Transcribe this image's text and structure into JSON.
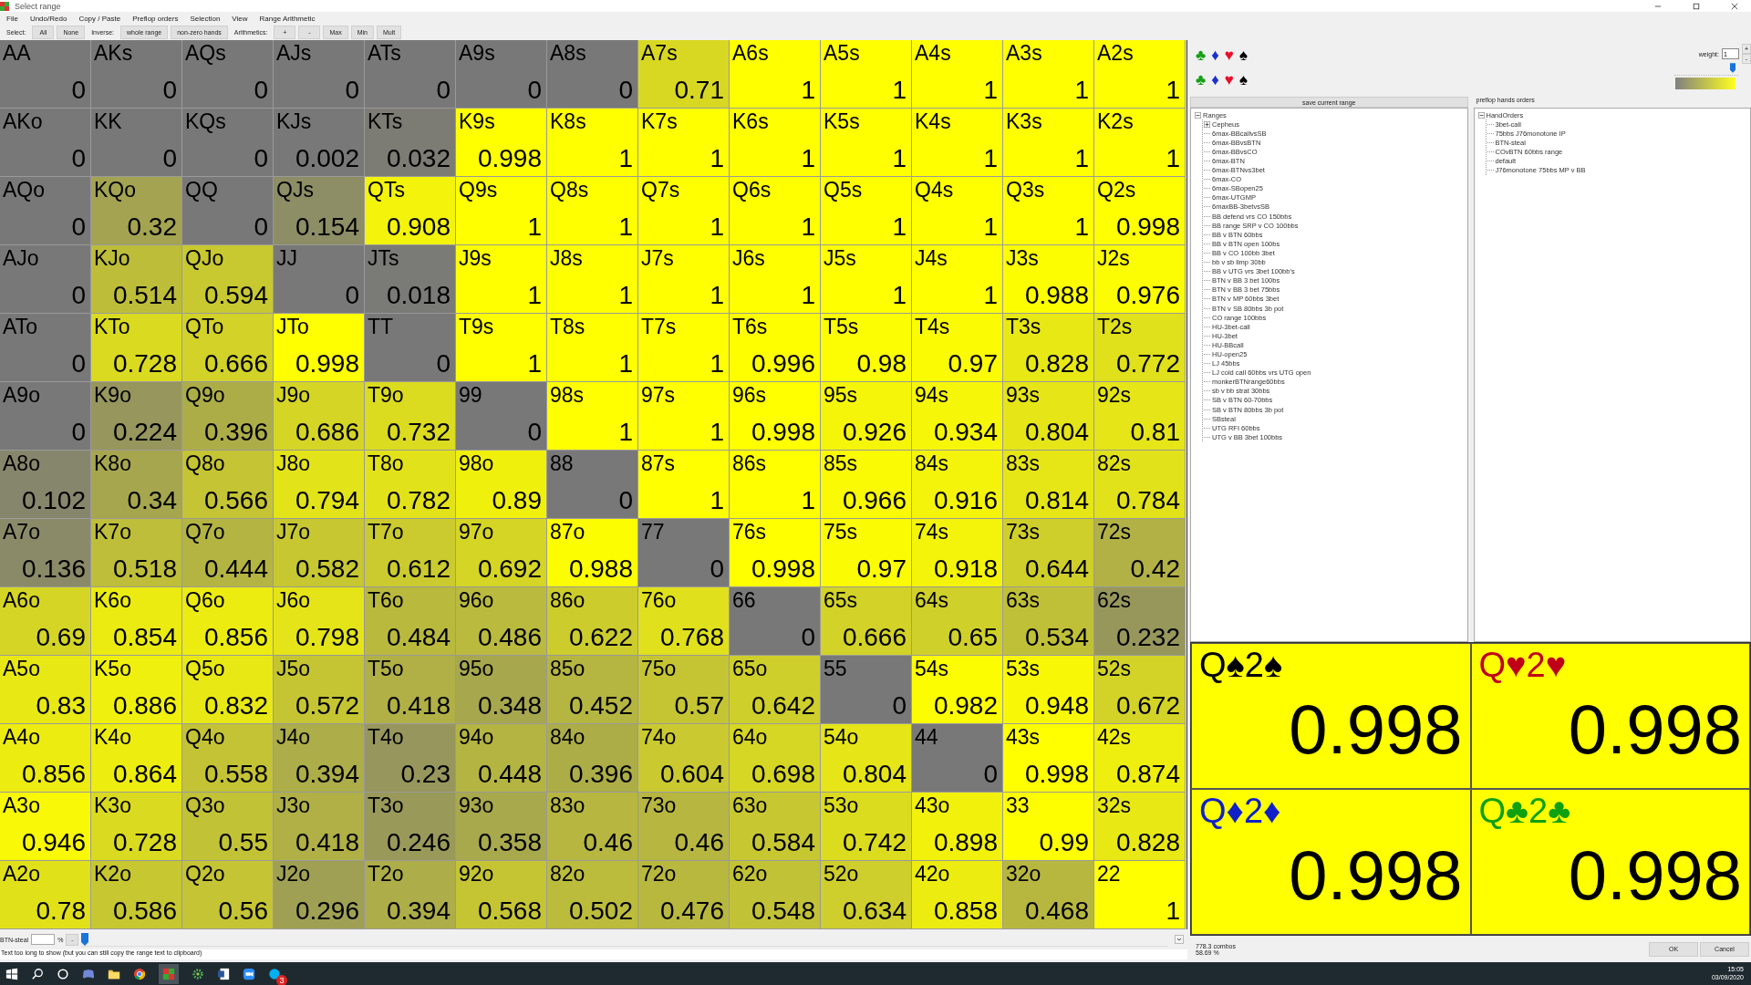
{
  "window": {
    "title": "Select range"
  },
  "menu": [
    "File",
    "Undo/Redo",
    "Copy / Paste",
    "Preflop orders",
    "Selection",
    "View",
    "Range Arithmetic"
  ],
  "toolbar": [
    {
      "kind": "label",
      "text": "Select:"
    },
    {
      "kind": "button",
      "text": "All"
    },
    {
      "kind": "button",
      "text": "None"
    },
    {
      "kind": "label",
      "text": "Inverse:"
    },
    {
      "kind": "button",
      "text": "whole range"
    },
    {
      "kind": "button",
      "text": "non-zero hands"
    },
    {
      "kind": "label",
      "text": "Arithmetics:"
    },
    {
      "kind": "button",
      "text": "+"
    },
    {
      "kind": "button",
      "text": "-"
    },
    {
      "kind": "button",
      "text": "Max"
    },
    {
      "kind": "button",
      "text": "Min"
    },
    {
      "kind": "button",
      "text": "Mult"
    }
  ],
  "grid": [
    {
      "cells": [
        {
          "hand": "AA",
          "value": "0",
          "color": "#787878"
        },
        {
          "hand": "AKs",
          "value": "0",
          "color": "#787878"
        },
        {
          "hand": "AQs",
          "value": "0",
          "color": "#787878"
        },
        {
          "hand": "AJs",
          "value": "0",
          "color": "#787878"
        },
        {
          "hand": "ATs",
          "value": "0",
          "color": "#787878"
        },
        {
          "hand": "A9s",
          "value": "0",
          "color": "#787878"
        },
        {
          "hand": "A8s",
          "value": "0",
          "color": "#787878"
        },
        {
          "hand": "A7s",
          "value": "0.71",
          "color": "#d8d823"
        },
        {
          "hand": "A6s",
          "value": "1",
          "color": "#ffff00"
        },
        {
          "hand": "A5s",
          "value": "1",
          "color": "#ffff00"
        },
        {
          "hand": "A4s",
          "value": "1",
          "color": "#ffff00"
        },
        {
          "hand": "A3s",
          "value": "1",
          "color": "#ffff00"
        },
        {
          "hand": "A2s",
          "value": "1",
          "color": "#ffff00"
        }
      ]
    },
    {
      "cells": [
        {
          "hand": "AKo",
          "value": "0",
          "color": "#787878"
        },
        {
          "hand": "KK",
          "value": "0",
          "color": "#787878"
        },
        {
          "hand": "KQs",
          "value": "0",
          "color": "#787878"
        },
        {
          "hand": "KJs",
          "value": "0.002",
          "color": "#787878"
        },
        {
          "hand": "KTs",
          "value": "0.032",
          "color": "#7c7c74"
        },
        {
          "hand": "K9s",
          "value": "0.998",
          "color": "#ffff00"
        },
        {
          "hand": "K8s",
          "value": "1",
          "color": "#ffff00"
        },
        {
          "hand": "K7s",
          "value": "1",
          "color": "#ffff00"
        },
        {
          "hand": "K6s",
          "value": "1",
          "color": "#ffff00"
        },
        {
          "hand": "K5s",
          "value": "1",
          "color": "#ffff00"
        },
        {
          "hand": "K4s",
          "value": "1",
          "color": "#ffff00"
        },
        {
          "hand": "K3s",
          "value": "1",
          "color": "#ffff00"
        },
        {
          "hand": "K2s",
          "value": "1",
          "color": "#ffff00"
        }
      ]
    },
    {
      "cells": [
        {
          "hand": "AQo",
          "value": "0",
          "color": "#787878"
        },
        {
          "hand": "KQo",
          "value": "0.32",
          "color": "#a3a352"
        },
        {
          "hand": "QQ",
          "value": "0",
          "color": "#787878"
        },
        {
          "hand": "QJs",
          "value": "0.154",
          "color": "#8d8d66"
        },
        {
          "hand": "QTs",
          "value": "0.908",
          "color": "#f3f30b"
        },
        {
          "hand": "Q9s",
          "value": "1",
          "color": "#ffff00"
        },
        {
          "hand": "Q8s",
          "value": "1",
          "color": "#ffff00"
        },
        {
          "hand": "Q7s",
          "value": "1",
          "color": "#ffff00"
        },
        {
          "hand": "Q6s",
          "value": "1",
          "color": "#ffff00"
        },
        {
          "hand": "Q5s",
          "value": "1",
          "color": "#ffff00"
        },
        {
          "hand": "Q4s",
          "value": "1",
          "color": "#ffff00"
        },
        {
          "hand": "Q3s",
          "value": "1",
          "color": "#ffff00"
        },
        {
          "hand": "Q2s",
          "value": "0.998",
          "color": "#ffff00"
        }
      ]
    },
    {
      "cells": [
        {
          "hand": "AJo",
          "value": "0",
          "color": "#787878"
        },
        {
          "hand": "KJo",
          "value": "0.514",
          "color": "#bdbd3a"
        },
        {
          "hand": "QJo",
          "value": "0.594",
          "color": "#c8c831"
        },
        {
          "hand": "JJ",
          "value": "0",
          "color": "#787878"
        },
        {
          "hand": "JTs",
          "value": "0.018",
          "color": "#7a7a76"
        },
        {
          "hand": "J9s",
          "value": "1",
          "color": "#ffff00"
        },
        {
          "hand": "J8s",
          "value": "1",
          "color": "#ffff00"
        },
        {
          "hand": "J7s",
          "value": "1",
          "color": "#ffff00"
        },
        {
          "hand": "J6s",
          "value": "1",
          "color": "#ffff00"
        },
        {
          "hand": "J5s",
          "value": "1",
          "color": "#ffff00"
        },
        {
          "hand": "J4s",
          "value": "1",
          "color": "#ffff00"
        },
        {
          "hand": "J3s",
          "value": "0.988",
          "color": "#fdfd01"
        },
        {
          "hand": "J2s",
          "value": "0.976",
          "color": "#fcfc03"
        }
      ]
    },
    {
      "cells": [
        {
          "hand": "ATo",
          "value": "0",
          "color": "#787878"
        },
        {
          "hand": "KTo",
          "value": "0.728",
          "color": "#dada21"
        },
        {
          "hand": "QTo",
          "value": "0.666",
          "color": "#d2d228"
        },
        {
          "hand": "JTo",
          "value": "0.998",
          "color": "#ffff00"
        },
        {
          "hand": "TT",
          "value": "0",
          "color": "#787878"
        },
        {
          "hand": "T9s",
          "value": "1",
          "color": "#ffff00"
        },
        {
          "hand": "T8s",
          "value": "1",
          "color": "#ffff00"
        },
        {
          "hand": "T7s",
          "value": "1",
          "color": "#ffff00"
        },
        {
          "hand": "T6s",
          "value": "0.996",
          "color": "#fefe00"
        },
        {
          "hand": "T5s",
          "value": "0.98",
          "color": "#fcfc02"
        },
        {
          "hand": "T4s",
          "value": "0.97",
          "color": "#fbfb04"
        },
        {
          "hand": "T3s",
          "value": "0.828",
          "color": "#e8e815"
        },
        {
          "hand": "T2s",
          "value": "0.772",
          "color": "#e0e01b"
        }
      ]
    },
    {
      "cells": [
        {
          "hand": "A9o",
          "value": "0",
          "color": "#787878"
        },
        {
          "hand": "K9o",
          "value": "0.224",
          "color": "#96965d"
        },
        {
          "hand": "Q9o",
          "value": "0.396",
          "color": "#adad48"
        },
        {
          "hand": "J9o",
          "value": "0.686",
          "color": "#d5d526"
        },
        {
          "hand": "T9o",
          "value": "0.732",
          "color": "#dbdb20"
        },
        {
          "hand": "99",
          "value": "0",
          "color": "#787878"
        },
        {
          "hand": "98s",
          "value": "1",
          "color": "#ffff00"
        },
        {
          "hand": "97s",
          "value": "1",
          "color": "#ffff00"
        },
        {
          "hand": "96s",
          "value": "0.998",
          "color": "#ffff00"
        },
        {
          "hand": "95s",
          "value": "0.926",
          "color": "#f5f509"
        },
        {
          "hand": "94s",
          "value": "0.934",
          "color": "#f6f608"
        },
        {
          "hand": "93s",
          "value": "0.804",
          "color": "#e5e518"
        },
        {
          "hand": "92s",
          "value": "0.81",
          "color": "#e5e517"
        }
      ]
    },
    {
      "cells": [
        {
          "hand": "A8o",
          "value": "0.102",
          "color": "#86866c"
        },
        {
          "hand": "K8o",
          "value": "0.34",
          "color": "#a6a64f"
        },
        {
          "hand": "Q8o",
          "value": "0.566",
          "color": "#c4c434"
        },
        {
          "hand": "J8o",
          "value": "0.794",
          "color": "#e3e319"
        },
        {
          "hand": "T8o",
          "value": "0.782",
          "color": "#e2e21a"
        },
        {
          "hand": "98o",
          "value": "0.89",
          "color": "#f0f00d"
        },
        {
          "hand": "88",
          "value": "0",
          "color": "#787878"
        },
        {
          "hand": "87s",
          "value": "1",
          "color": "#ffff00"
        },
        {
          "hand": "86s",
          "value": "1",
          "color": "#ffff00"
        },
        {
          "hand": "85s",
          "value": "0.966",
          "color": "#fafa04"
        },
        {
          "hand": "84s",
          "value": "0.916",
          "color": "#f4f40a"
        },
        {
          "hand": "83s",
          "value": "0.814",
          "color": "#e6e616"
        },
        {
          "hand": "82s",
          "value": "0.784",
          "color": "#e2e21a"
        }
      ]
    },
    {
      "cells": [
        {
          "hand": "A7o",
          "value": "0.136",
          "color": "#8a8a68"
        },
        {
          "hand": "K7o",
          "value": "0.518",
          "color": "#bebe3a"
        },
        {
          "hand": "Q7o",
          "value": "0.444",
          "color": "#b4b443"
        },
        {
          "hand": "J7o",
          "value": "0.582",
          "color": "#c7c732"
        },
        {
          "hand": "T7o",
          "value": "0.612",
          "color": "#cbcb2f"
        },
        {
          "hand": "97o",
          "value": "0.692",
          "color": "#d5d525"
        },
        {
          "hand": "87o",
          "value": "0.988",
          "color": "#fdfd01"
        },
        {
          "hand": "77",
          "value": "0",
          "color": "#787878"
        },
        {
          "hand": "76s",
          "value": "0.998",
          "color": "#ffff00"
        },
        {
          "hand": "75s",
          "value": "0.97",
          "color": "#fbfb04"
        },
        {
          "hand": "74s",
          "value": "0.918",
          "color": "#f4f40a"
        },
        {
          "hand": "73s",
          "value": "0.644",
          "color": "#cfcf2b"
        },
        {
          "hand": "72s",
          "value": "0.42",
          "color": "#b1b146"
        }
      ]
    },
    {
      "cells": [
        {
          "hand": "A6o",
          "value": "0.69",
          "color": "#d5d525"
        },
        {
          "hand": "K6o",
          "value": "0.854",
          "color": "#ebeb12"
        },
        {
          "hand": "Q6o",
          "value": "0.856",
          "color": "#ecec11"
        },
        {
          "hand": "J6o",
          "value": "0.798",
          "color": "#e4e418"
        },
        {
          "hand": "T6o",
          "value": "0.484",
          "color": "#b9b93e"
        },
        {
          "hand": "96o",
          "value": "0.486",
          "color": "#baba3e"
        },
        {
          "hand": "86o",
          "value": "0.622",
          "color": "#cccc2d"
        },
        {
          "hand": "76o",
          "value": "0.768",
          "color": "#e0e01c"
        },
        {
          "hand": "66",
          "value": "0",
          "color": "#787878"
        },
        {
          "hand": "65s",
          "value": "0.666",
          "color": "#d2d228"
        },
        {
          "hand": "64s",
          "value": "0.65",
          "color": "#d0d02a"
        },
        {
          "hand": "63s",
          "value": "0.534",
          "color": "#c0c038"
        },
        {
          "hand": "62s",
          "value": "0.232",
          "color": "#97975c"
        }
      ]
    },
    {
      "cells": [
        {
          "hand": "A5o",
          "value": "0.83",
          "color": "#e8e814"
        },
        {
          "hand": "K5o",
          "value": "0.886",
          "color": "#f0f00e"
        },
        {
          "hand": "Q5o",
          "value": "0.832",
          "color": "#e8e815"
        },
        {
          "hand": "J5o",
          "value": "0.572",
          "color": "#c5c533"
        },
        {
          "hand": "T5o",
          "value": "0.418",
          "color": "#b0b046"
        },
        {
          "hand": "95o",
          "value": "0.348",
          "color": "#a7a74e"
        },
        {
          "hand": "85o",
          "value": "0.452",
          "color": "#b5b542"
        },
        {
          "hand": "75o",
          "value": "0.57",
          "color": "#c5c534"
        },
        {
          "hand": "65o",
          "value": "0.642",
          "color": "#cfcf2c"
        },
        {
          "hand": "55",
          "value": "0",
          "color": "#787878"
        },
        {
          "hand": "54s",
          "value": "0.982",
          "color": "#fdfd02"
        },
        {
          "hand": "53s",
          "value": "0.948",
          "color": "#f8f806"
        },
        {
          "hand": "52s",
          "value": "0.672",
          "color": "#d3d327"
        }
      ]
    },
    {
      "cells": [
        {
          "hand": "A4o",
          "value": "0.856",
          "color": "#ecec11"
        },
        {
          "hand": "K4o",
          "value": "0.864",
          "color": "#eded10"
        },
        {
          "hand": "Q4o",
          "value": "0.558",
          "color": "#c3c335"
        },
        {
          "hand": "J4o",
          "value": "0.394",
          "color": "#adad49"
        },
        {
          "hand": "T4o",
          "value": "0.23",
          "color": "#97975d"
        },
        {
          "hand": "94o",
          "value": "0.448",
          "color": "#b4b442"
        },
        {
          "hand": "84o",
          "value": "0.396",
          "color": "#adad48"
        },
        {
          "hand": "74o",
          "value": "0.604",
          "color": "#caca30"
        },
        {
          "hand": "64o",
          "value": "0.698",
          "color": "#d6d624"
        },
        {
          "hand": "54o",
          "value": "0.804",
          "color": "#e5e518"
        },
        {
          "hand": "44",
          "value": "0",
          "color": "#787878"
        },
        {
          "hand": "43s",
          "value": "0.998",
          "color": "#ffff00"
        },
        {
          "hand": "42s",
          "value": "0.874",
          "color": "#eeee0f"
        }
      ]
    },
    {
      "cells": [
        {
          "hand": "A3o",
          "value": "0.946",
          "color": "#f8f807"
        },
        {
          "hand": "K3o",
          "value": "0.728",
          "color": "#dada21"
        },
        {
          "hand": "Q3o",
          "value": "0.55",
          "color": "#c2c236"
        },
        {
          "hand": "J3o",
          "value": "0.418",
          "color": "#b0b046"
        },
        {
          "hand": "T3o",
          "value": "0.246",
          "color": "#99995a"
        },
        {
          "hand": "93o",
          "value": "0.358",
          "color": "#a8a84d"
        },
        {
          "hand": "83o",
          "value": "0.46",
          "color": "#b6b641"
        },
        {
          "hand": "73o",
          "value": "0.46",
          "color": "#b6b641"
        },
        {
          "hand": "63o",
          "value": "0.584",
          "color": "#c7c732"
        },
        {
          "hand": "53o",
          "value": "0.742",
          "color": "#dcdc1f"
        },
        {
          "hand": "43o",
          "value": "0.898",
          "color": "#f1f10c"
        },
        {
          "hand": "33",
          "value": "0.99",
          "color": "#fefe01"
        },
        {
          "hand": "32s",
          "value": "0.828",
          "color": "#e8e815"
        }
      ]
    },
    {
      "cells": [
        {
          "hand": "A2o",
          "value": "0.78",
          "color": "#e1e11a"
        },
        {
          "hand": "K2o",
          "value": "0.586",
          "color": "#c7c731"
        },
        {
          "hand": "Q2o",
          "value": "0.56",
          "color": "#c4c435"
        },
        {
          "hand": "J2o",
          "value": "0.296",
          "color": "#a0a054"
        },
        {
          "hand": "T2o",
          "value": "0.394",
          "color": "#adad49"
        },
        {
          "hand": "92o",
          "value": "0.568",
          "color": "#c5c534"
        },
        {
          "hand": "82o",
          "value": "0.502",
          "color": "#bcbc3c"
        },
        {
          "hand": "72o",
          "value": "0.476",
          "color": "#b8b83f"
        },
        {
          "hand": "62o",
          "value": "0.548",
          "color": "#c2c236"
        },
        {
          "hand": "52o",
          "value": "0.634",
          "color": "#cece2c"
        },
        {
          "hand": "42o",
          "value": "0.858",
          "color": "#ecec11"
        },
        {
          "hand": "32o",
          "value": "0.468",
          "color": "#b7b740"
        },
        {
          "hand": "22",
          "value": "1",
          "color": "#ffff00"
        }
      ]
    }
  ],
  "steal_bar": {
    "label": "BTN-steal",
    "unit": "%",
    "button": "-",
    "level": 0
  },
  "status_text": "Text too long to show (but you can still copy the range text to clipboard)",
  "suit_rows": [
    {
      "suits": [
        {
          "symbol": "♣",
          "color": "#14a014"
        },
        {
          "symbol": "♦",
          "color": "#1c2fd0"
        },
        {
          "symbol": "♥",
          "color": "#e8102a"
        },
        {
          "symbol": "♠",
          "color": "#000000"
        }
      ]
    },
    {
      "suits": [
        {
          "symbol": "♣",
          "color": "#14a014"
        },
        {
          "symbol": "♦",
          "color": "#1c2fd0"
        },
        {
          "symbol": "♥",
          "color": "#e8102a"
        },
        {
          "symbol": "♠",
          "color": "#000000"
        }
      ]
    }
  ],
  "weight": {
    "label": "weight:",
    "value": "1",
    "plus": "+",
    "minus": "-",
    "level": 0.95
  },
  "ranges_panel": {
    "button": "save current range",
    "tree": [
      {
        "label": "Ranges",
        "kind": "folder",
        "expanded": true,
        "children": [
          {
            "label": "Cepheus",
            "kind": "folder",
            "expanded": false
          },
          {
            "label": "6max-BBcallvsSB",
            "kind": "leaf"
          },
          {
            "label": "6max-BBvsBTN",
            "kind": "leaf"
          },
          {
            "label": "6max-BBvsCO",
            "kind": "leaf"
          },
          {
            "label": "6max-BTN",
            "kind": "leaf"
          },
          {
            "label": "6max-BTNvs3bet",
            "kind": "leaf"
          },
          {
            "label": "6max-CO",
            "kind": "leaf"
          },
          {
            "label": "6max-SBopen25",
            "kind": "leaf"
          },
          {
            "label": "6max-UTGMP",
            "kind": "leaf"
          },
          {
            "label": "6maxBB-3betvsSB",
            "kind": "leaf"
          },
          {
            "label": "BB defend vrs CO 150bbs",
            "kind": "leaf"
          },
          {
            "label": "BB range SRP v CO 100bbs",
            "kind": "leaf"
          },
          {
            "label": "BB v BTN 60bbs",
            "kind": "leaf"
          },
          {
            "label": "BB v BTN open 100bs",
            "kind": "leaf"
          },
          {
            "label": "BB v CO 100bb 3bet",
            "kind": "leaf"
          },
          {
            "label": "bb v sb limp 30bb",
            "kind": "leaf"
          },
          {
            "label": "BB v UTG vrs 3bet 100bb's",
            "kind": "leaf"
          },
          {
            "label": "BTN v BB 3 bet 100bs",
            "kind": "leaf"
          },
          {
            "label": "BTN v BB 3 bet 75bbs",
            "kind": "leaf"
          },
          {
            "label": "BTN v MP 60bbs 3bet",
            "kind": "leaf"
          },
          {
            "label": "BTN v SB 80bbs 3b pot",
            "kind": "leaf"
          },
          {
            "label": "CO range 100bbs",
            "kind": "leaf"
          },
          {
            "label": "HU-3bet-call",
            "kind": "leaf"
          },
          {
            "label": "HU-3bet",
            "kind": "leaf"
          },
          {
            "label": "HU-BBcall",
            "kind": "leaf"
          },
          {
            "label": "HU-open25",
            "kind": "leaf"
          },
          {
            "label": "LJ 45bbs",
            "kind": "leaf"
          },
          {
            "label": "LJ cold call 60bbs vrs UTG open",
            "kind": "leaf"
          },
          {
            "label": "monkerBTNrange60bbs",
            "kind": "leaf"
          },
          {
            "label": "sb v bb strat 30bbs",
            "kind": "leaf"
          },
          {
            "label": "SB v BTN 60-70bbs",
            "kind": "leaf"
          },
          {
            "label": "SB v BTN 80bbs 3b pot",
            "kind": "leaf"
          },
          {
            "label": "SBsteal",
            "kind": "leaf"
          },
          {
            "label": "UTG RFI 60bbs",
            "kind": "leaf"
          },
          {
            "label": "UTG v BB 3bet 100bbs",
            "kind": "leaf"
          }
        ]
      }
    ]
  },
  "orders_panel": {
    "title": "preflop hands orders",
    "tree": [
      {
        "label": "HandOrders",
        "kind": "folder",
        "expanded": true,
        "children": [
          {
            "label": "3bet-call",
            "kind": "leaf"
          },
          {
            "label": "75bbs J76monotone IP",
            "kind": "leaf"
          },
          {
            "label": "BTN-steal",
            "kind": "leaf"
          },
          {
            "label": "COvBTN 60bbs range",
            "kind": "leaf"
          },
          {
            "label": "default",
            "kind": "leaf"
          },
          {
            "label": "J76monotone 75bbs MP v BB",
            "kind": "leaf"
          }
        ]
      }
    ]
  },
  "combos": [
    {
      "combo": "Q♠2♠",
      "color": "#000000",
      "value": "0.998"
    },
    {
      "combo": "Q♥2♥",
      "color": "#c00018",
      "value": "0.998"
    },
    {
      "combo": "Q♦2♦",
      "color": "#1020c8",
      "value": "0.998"
    },
    {
      "combo": "Q♣2♣",
      "color": "#10a010",
      "value": "0.998"
    }
  ],
  "summary": {
    "combos": "778.3 combos",
    "percent": "58.69 %"
  },
  "buttons": [
    "OK",
    "Cancel"
  ],
  "taskbar": {
    "badge": "3",
    "time": "15:05",
    "date": "03/09/2020"
  }
}
